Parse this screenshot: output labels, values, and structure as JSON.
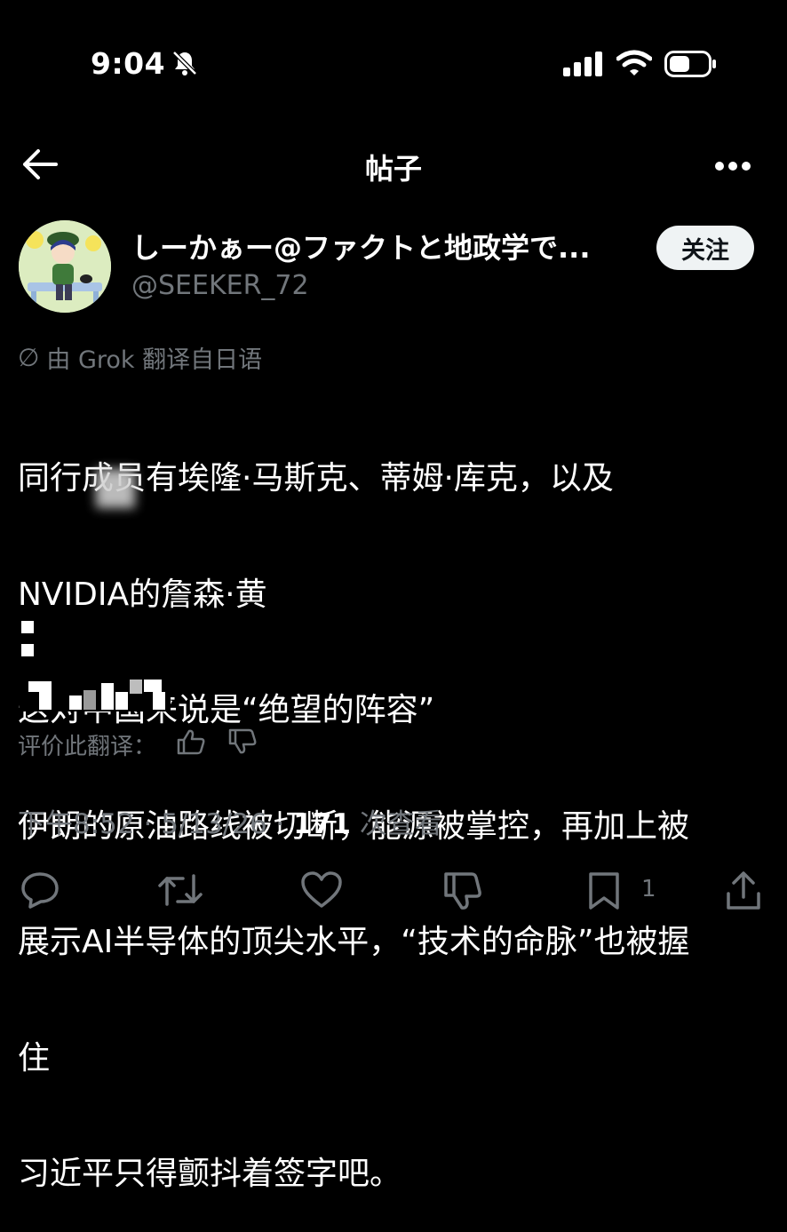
{
  "status_bar": {
    "time": "9:04"
  },
  "header": {
    "title": "帖子"
  },
  "author": {
    "display_name": "しーかぁー@ファクトと地政学で...",
    "handle": "@SEEKER_72",
    "follow_label": "关注"
  },
  "translation": {
    "translated_by": "由 Grok 翻译自日语",
    "rate_label": "评价此翻译："
  },
  "post": {
    "lines": [
      "同行成员有埃隆·马斯克、蒂姆·库克，以及",
      "NVIDIA的詹森·黄",
      "这对中国来说是“绝望的阵容”",
      "伊朗的原油路线被切断，能源被掌控，再加上被",
      "展示AI半导体的顶尖水平，“技术的命脉”也被握",
      "住",
      "习近平只得颤抖着签字吧。"
    ]
  },
  "meta": {
    "time": "下午8:52",
    "date": "5/13/26",
    "views": "171",
    "views_label": "次查看"
  },
  "actions": {
    "bookmark_count": "1"
  },
  "colors": {
    "background": "#000000",
    "text": "#ffffff",
    "secondary": "#71767b",
    "follow_bg": "#eff3f4"
  }
}
